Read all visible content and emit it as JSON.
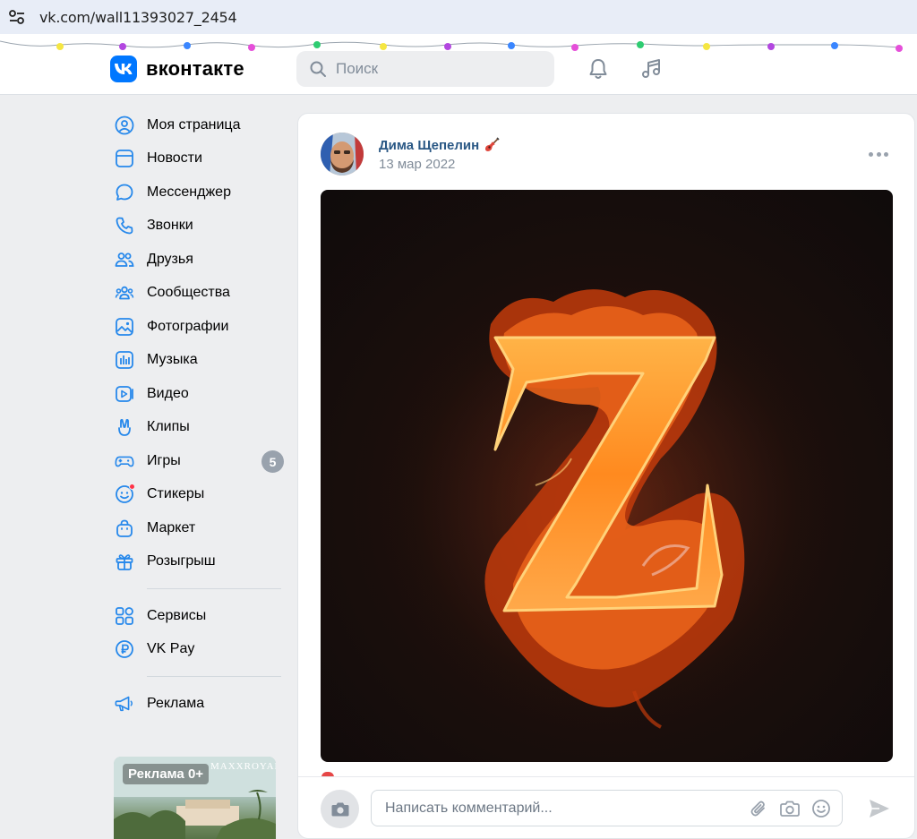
{
  "browser": {
    "url": "vk.com/wall11393027_2454",
    "tune_icon": "tune-icon"
  },
  "header": {
    "logo_text": "вконтакте",
    "search_placeholder": "Поиск",
    "icons": [
      "bell-icon",
      "music-note-icon"
    ]
  },
  "colors": {
    "accent": "#0077ff",
    "link": "#2a5885",
    "muted": "#818c99",
    "badge": "#99a2ad",
    "notify": "#ff3347"
  },
  "sidebar": {
    "items": [
      {
        "label": "Моя страница",
        "icon": "user-circle-icon"
      },
      {
        "label": "Новости",
        "icon": "newsfeed-icon"
      },
      {
        "label": "Мессенджер",
        "icon": "message-icon"
      },
      {
        "label": "Звонки",
        "icon": "phone-icon"
      },
      {
        "label": "Друзья",
        "icon": "friends-icon"
      },
      {
        "label": "Сообщества",
        "icon": "communities-icon"
      },
      {
        "label": "Фотографии",
        "icon": "photos-icon"
      },
      {
        "label": "Музыка",
        "icon": "music-icon"
      },
      {
        "label": "Видео",
        "icon": "video-icon"
      },
      {
        "label": "Клипы",
        "icon": "clips-icon"
      },
      {
        "label": "Игры",
        "icon": "gamepad-icon",
        "badge": "5"
      },
      {
        "label": "Стикеры",
        "icon": "sticker-icon"
      },
      {
        "label": "Маркет",
        "icon": "market-bag-icon"
      },
      {
        "label": "Розыгрыш",
        "icon": "gift-icon"
      }
    ],
    "services": [
      {
        "label": "Сервисы",
        "icon": "services-grid-icon"
      },
      {
        "label": "VK Pay",
        "icon": "ruble-icon"
      }
    ],
    "ads": [
      {
        "label": "Реклама",
        "icon": "megaphone-icon"
      }
    ],
    "ad_card": {
      "label": "Реклама 0+",
      "brand": "MAXXROYAL"
    }
  },
  "post": {
    "author": "Дима Щепелин",
    "author_emoji_icon": "guitar-icon",
    "date": "13 мар 2022",
    "image_icon": "flaming-letter-z-image",
    "comment_placeholder": "Написать комментарий...",
    "comment_icons": [
      "paperclip-icon",
      "camera-icon",
      "smile-icon"
    ]
  }
}
